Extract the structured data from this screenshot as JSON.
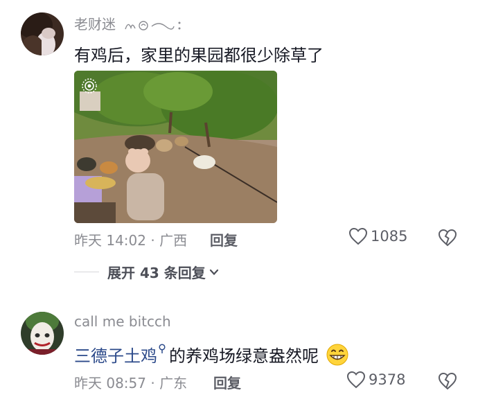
{
  "comments": [
    {
      "username": "老财迷",
      "text": "有鸡后，家里的果园都很少除草了",
      "time": "昨天 14:02",
      "location": "广西",
      "reply_label": "回复",
      "likes": "1085",
      "expand_label": "展开 43 条回复"
    },
    {
      "username": "call me bitcch",
      "mention": "三德子土鸡",
      "text": "的养鸡场绿意盎然呢",
      "time": "昨天 08:57",
      "location": "广东",
      "reply_label": "回复",
      "likes": "9378"
    }
  ],
  "separator": "·",
  "icons": {
    "like": "heart-outline-icon",
    "dislike": "broken-heart-icon",
    "expand": "chevron-down-icon",
    "emoji": "grinning-emoji-icon",
    "search": "search-small-icon"
  },
  "colors": {
    "primary_text": "#161823",
    "secondary_text": "#8a8b91",
    "mention": "#2c4a8a"
  }
}
